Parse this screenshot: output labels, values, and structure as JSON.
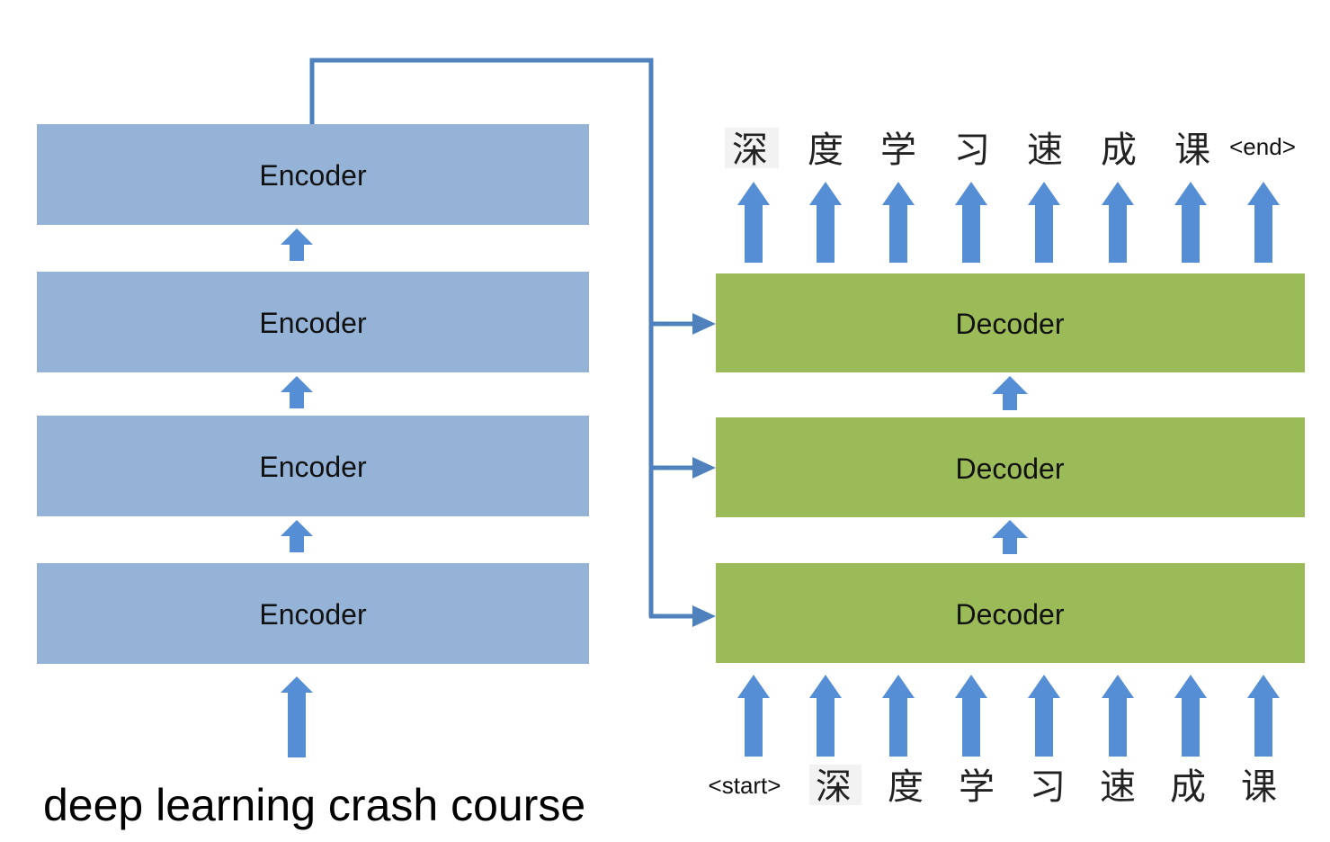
{
  "encoder": {
    "blocks": [
      "Encoder",
      "Encoder",
      "Encoder",
      "Encoder"
    ]
  },
  "decoder": {
    "blocks": [
      "Decoder",
      "Decoder",
      "Decoder"
    ]
  },
  "source_sentence": "deep learning crash course",
  "output_tokens": [
    "深",
    "度",
    "学",
    "习",
    "速",
    "成",
    "课",
    "<end>"
  ],
  "input_tokens": [
    "<start>",
    "深",
    "度",
    "学",
    "习",
    "速",
    "成",
    "课"
  ],
  "colors": {
    "encoder_fill": "#95B3D7",
    "decoder_fill": "#9BBB59",
    "arrow": "#558ED5",
    "connector": "#4F81BD"
  }
}
